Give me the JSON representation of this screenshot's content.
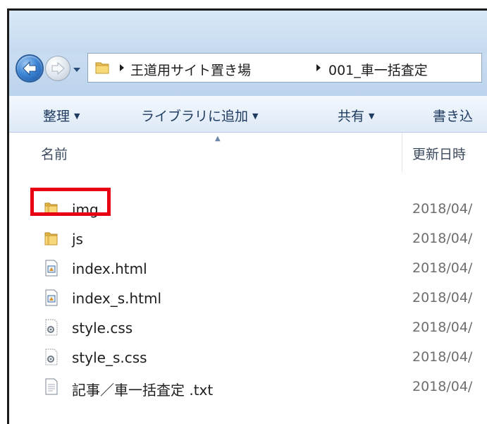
{
  "address": {
    "segments": [
      "王道用サイト置き場",
      "001_車一括査定"
    ]
  },
  "toolbar": {
    "organize": "整理",
    "add_to_library": "ライブラリに追加",
    "share": "共有",
    "burn": "書き込"
  },
  "columns": {
    "name": "名前",
    "date_modified": "更新日時"
  },
  "files": [
    {
      "name": "img",
      "date": "2018/04/",
      "type": "folder"
    },
    {
      "name": "js",
      "date": "2018/04/",
      "type": "folder"
    },
    {
      "name": "index.html",
      "date": "2018/04/",
      "type": "html"
    },
    {
      "name": "index_s.html",
      "date": "2018/04/",
      "type": "html"
    },
    {
      "name": "style.css",
      "date": "2018/04/",
      "type": "css"
    },
    {
      "name": "style_s.css",
      "date": "2018/04/",
      "type": "css"
    },
    {
      "name": "記事／車一括査定 .txt",
      "date": "2018/04/",
      "type": "txt"
    }
  ],
  "highlight": {
    "target": "img",
    "color": "#e60012"
  }
}
